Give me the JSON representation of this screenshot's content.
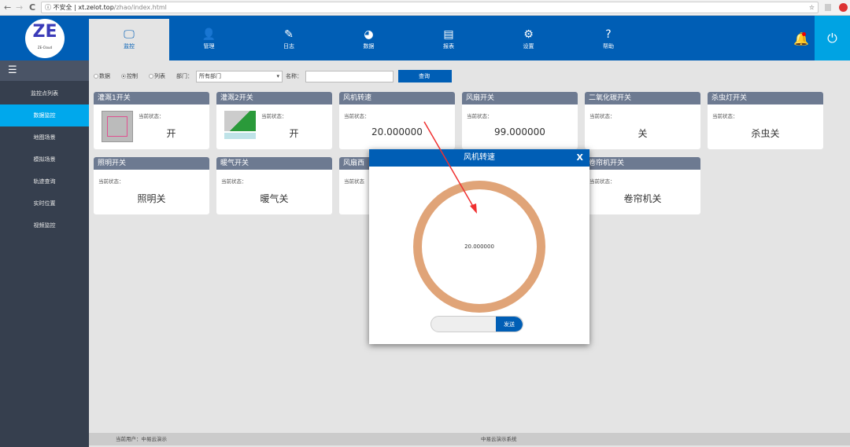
{
  "browser": {
    "back": "←",
    "forward": "→",
    "reload": "C",
    "security": "ⓘ 不安全",
    "url_host": "xt.zelot.top",
    "url_path": "/zhao/index.html",
    "star": "☆"
  },
  "logo": {
    "mark": "ZE",
    "caption": "ZE-Cloud"
  },
  "nav": [
    {
      "label": "监控",
      "icon": "monitor-icon",
      "glyph": "🖵"
    },
    {
      "label": "管理",
      "icon": "user-gear-icon",
      "glyph": "👤"
    },
    {
      "label": "日志",
      "icon": "notebook-icon",
      "glyph": "✎"
    },
    {
      "label": "数据",
      "icon": "pie-chart-icon",
      "glyph": "◕"
    },
    {
      "label": "报表",
      "icon": "report-icon",
      "glyph": "▤"
    },
    {
      "label": "设置",
      "icon": "gear-icon",
      "glyph": "⚙"
    },
    {
      "label": "帮助",
      "icon": "help-icon",
      "glyph": "?"
    }
  ],
  "header_icons": {
    "bell": "🔔",
    "power": "⏻"
  },
  "sidebar": {
    "menu": "☰",
    "items": [
      "监控点列表",
      "数据监控",
      "地图场景",
      "模拟场景",
      "轨迹查询",
      "实时位置",
      "视频监控"
    ],
    "active": 1
  },
  "filter": {
    "radios": [
      "数据",
      "控制",
      "列表"
    ],
    "selected": "控制",
    "dept_label": "部门：",
    "dept_value": "所有部门",
    "name_label": "名称：",
    "name_value": "",
    "query": "查询"
  },
  "cards": [
    {
      "title": "灌溉1开关",
      "status_label": "当前状态：",
      "value": "开"
    },
    {
      "title": "灌溉2开关",
      "status_label": "当前状态：",
      "value": "开"
    },
    {
      "title": "风机转速",
      "status_label": "当前状态：",
      "value": "20.000000"
    },
    {
      "title": "风扇开关",
      "status_label": "当前状态：",
      "value": "99.000000"
    },
    {
      "title": "二氧化碳开关",
      "status_label": "当前状态：",
      "value": "关"
    },
    {
      "title": "杀虫灯开关",
      "status_label": "当前状态：",
      "value": "杀虫关"
    },
    {
      "title": "照明开关",
      "status_label": "当前状态：",
      "value": "照明关"
    },
    {
      "title": "暖气开关",
      "status_label": "当前状态：",
      "value": "暖气关"
    },
    {
      "title": "风扇西",
      "status_label": "当前状态",
      "value": ""
    },
    {
      "title": "卷帘机开关",
      "status_label": "当前状态：",
      "value": "卷帘机关"
    }
  ],
  "modal": {
    "title": "风机转速",
    "close": "X",
    "gauge_value": "20.000000",
    "input_value": "",
    "send": "发送",
    "gauge_color": "#e0a478"
  },
  "footer": {
    "user": "当前用户：中易云演示",
    "system": "中易云演示系统"
  },
  "colors": {
    "primary": "#005eb5",
    "accent": "#00a8ec",
    "sidebar": "#363f4e",
    "card_header": "#6d7a91"
  }
}
